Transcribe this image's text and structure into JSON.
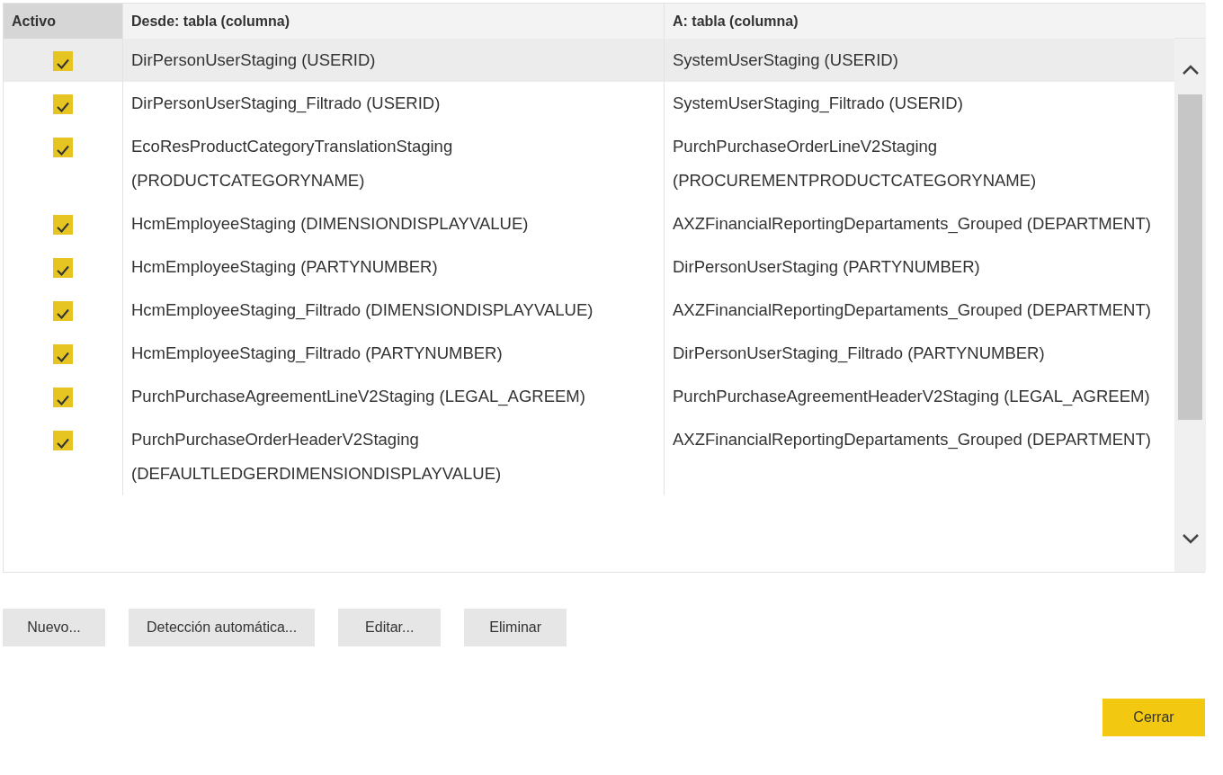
{
  "table": {
    "columns": [
      {
        "label": "Activo",
        "selected": true
      },
      {
        "label": "Desde: tabla (columna)",
        "selected": false
      },
      {
        "label": "A: tabla (columna)",
        "selected": false
      }
    ],
    "rows": [
      {
        "active": true,
        "selected": true,
        "from": "DirPersonUserStaging (USERID)",
        "to": "SystemUserStaging (USERID)"
      },
      {
        "active": true,
        "selected": false,
        "from": "DirPersonUserStaging_Filtrado (USERID)",
        "to": "SystemUserStaging_Filtrado (USERID)"
      },
      {
        "active": true,
        "selected": false,
        "from": "EcoResProductCategoryTranslationStaging (PRODUCTCATEGORYNAME)",
        "to": "PurchPurchaseOrderLineV2Staging (PROCUREMENTPRODUCTCATEGORYNAME)"
      },
      {
        "active": true,
        "selected": false,
        "from": "HcmEmployeeStaging (DIMENSIONDISPLAYVALUE)",
        "to": "AXZFinancialReportingDepartaments_Grouped (DEPARTMENT)"
      },
      {
        "active": true,
        "selected": false,
        "from": "HcmEmployeeStaging (PARTYNUMBER)",
        "to": "DirPersonUserStaging (PARTYNUMBER)"
      },
      {
        "active": true,
        "selected": false,
        "from": "HcmEmployeeStaging_Filtrado (DIMENSIONDISPLAYVALUE)",
        "to": "AXZFinancialReportingDepartaments_Grouped (DEPARTMENT)"
      },
      {
        "active": true,
        "selected": false,
        "from": "HcmEmployeeStaging_Filtrado (PARTYNUMBER)",
        "to": "DirPersonUserStaging_Filtrado (PARTYNUMBER)"
      },
      {
        "active": true,
        "selected": false,
        "from": "PurchPurchaseAgreementLineV2Staging (LEGAL_AGREEM)",
        "to": "PurchPurchaseAgreementHeaderV2Staging (LEGAL_AGREEM)"
      },
      {
        "active": true,
        "selected": false,
        "from": "PurchPurchaseOrderHeaderV2Staging (DEFAULTLEDGERDIMENSIONDISPLAYVALUE)",
        "to": "AXZFinancialReportingDepartaments_Grouped (DEPARTMENT)"
      }
    ]
  },
  "buttons": [
    {
      "label": "Nuevo...",
      "kind": "secondary"
    },
    {
      "label": "Detección automática...",
      "kind": "secondary"
    },
    {
      "label": "Editar...",
      "kind": "secondary"
    },
    {
      "label": "Eliminar",
      "kind": "secondary"
    }
  ],
  "footer_buttons": [
    {
      "label": "Cerrar",
      "kind": "primary"
    }
  ]
}
